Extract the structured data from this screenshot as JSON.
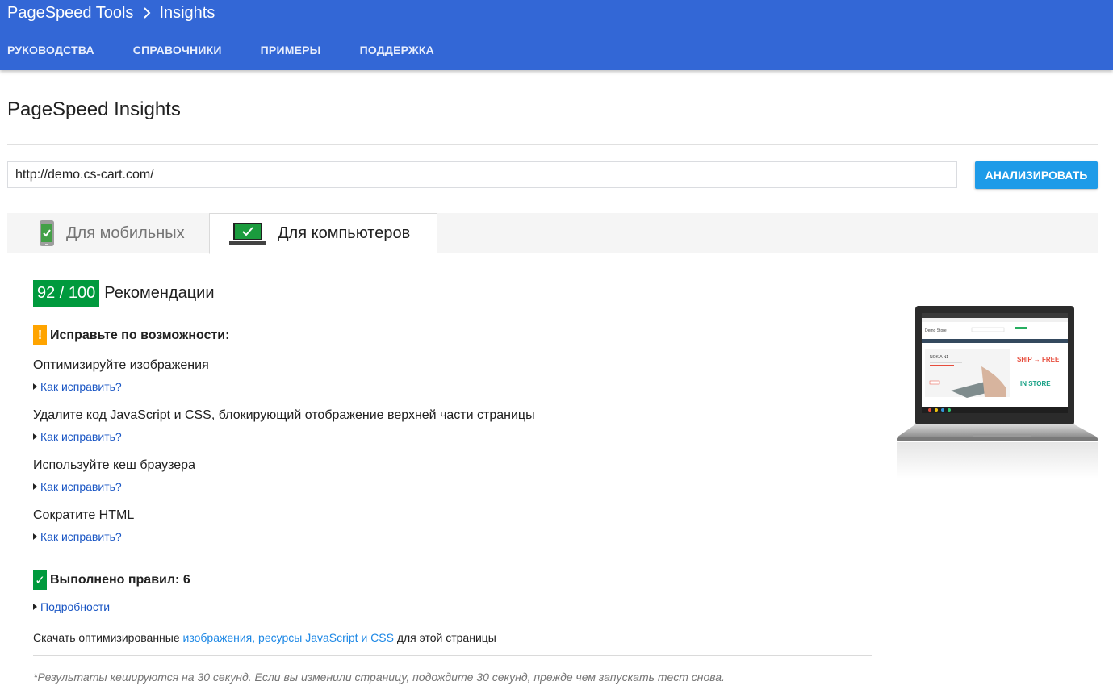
{
  "header": {
    "product": "PageSpeed Tools",
    "section": "Insights",
    "nav": [
      "РУКОВОДСТВА",
      "СПРАВОЧНИКИ",
      "ПРИМЕРЫ",
      "ПОДДЕРЖКА"
    ]
  },
  "page": {
    "title": "PageSpeed Insights"
  },
  "search": {
    "url_value": "http://demo.cs-cart.com/",
    "analyze_label": "АНАЛИЗИРОВАТЬ"
  },
  "tabs": [
    {
      "label": "Для мобильных",
      "active": false
    },
    {
      "label": "Для компьютеров",
      "active": true
    }
  ],
  "score": {
    "value": "92 / 100",
    "label": "Рекомендации",
    "color": "#009a3d"
  },
  "fix_section": {
    "title": "Исправьте по возможности:",
    "badge": "!",
    "color": "#ffa400",
    "rules": [
      {
        "title": "Оптимизируйте изображения",
        "link": "Как исправить?"
      },
      {
        "title": "Удалите код JavaScript и CSS, блокирующий отображение верхней части страницы",
        "link": "Как исправить?"
      },
      {
        "title": "Используйте кеш браузера",
        "link": "Как исправить?"
      },
      {
        "title": "Сократите HTML",
        "link": "Как исправить?"
      }
    ]
  },
  "passed_section": {
    "title": "Выполнено правил: 6",
    "badge": "✓",
    "link": "Подробности"
  },
  "download": {
    "prefix": "Скачать оптимизированные ",
    "link": "изображения, ресурсы JavaScript и CSS",
    "suffix": " для этой страницы"
  },
  "footnote": "*Результаты кешируются на 30 секунд. Если вы изменили страницу, подождите 30 секунд, прежде чем запускать тест снова.",
  "preview": {
    "logo": "Demo Store",
    "promo_title": "NOKIA N1",
    "ship_text": "SHIP → FREE",
    "store_text": "IN STORE"
  }
}
